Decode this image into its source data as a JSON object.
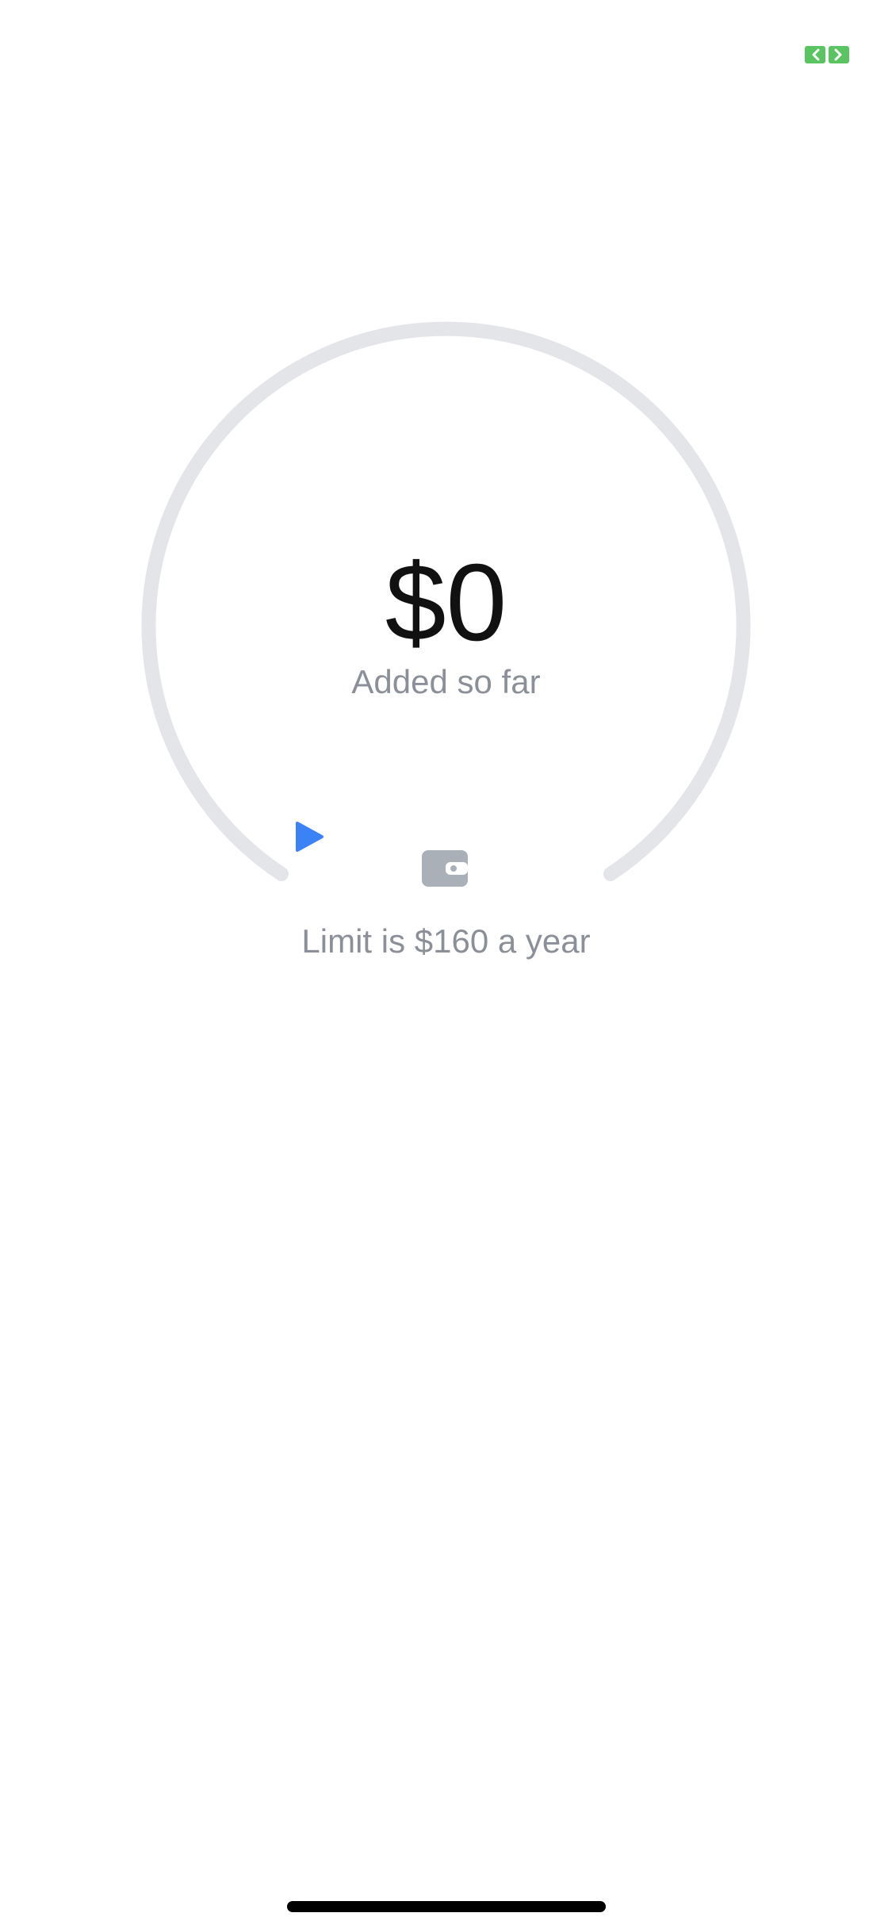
{
  "header": {
    "top_right_icon": "money-swap-icon"
  },
  "gauge": {
    "amount": "$0",
    "amount_caption": "Added so far",
    "limit_text": "Limit is $160 a year",
    "progress_fraction": 0,
    "track_color": "#e3e5e9",
    "marker_color": "#3b82f6",
    "marker_icon": "play-triangle-icon",
    "center_icon": "wallet-icon"
  },
  "colors": {
    "accent_green": "#5ac461",
    "muted_text": "#8b9098",
    "wallet_gray": "#aab0b8"
  }
}
